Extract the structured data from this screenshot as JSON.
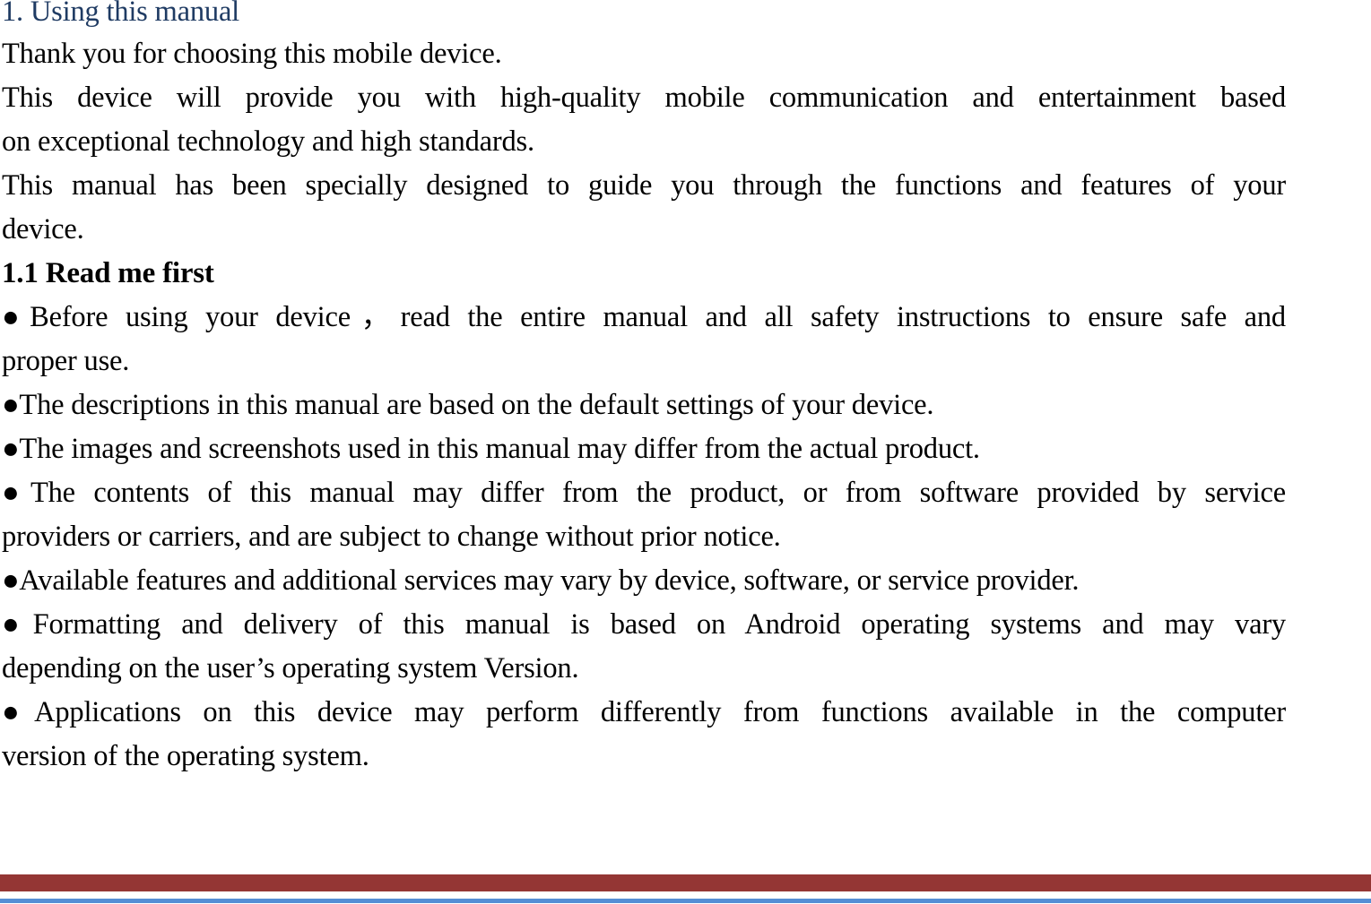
{
  "document": {
    "section_title": "1. Using this manual",
    "intro": {
      "line1": "Thank you for choosing this mobile device.",
      "para2_line1": "This device will provide you with high-quality mobile communication and entertainment based",
      "para2_line2": "on exceptional technology and high standards.",
      "para3_line1": "This manual has been specially designed to guide you through the functions and features of your",
      "para3_line2": "device."
    },
    "subsection_title": "1.1 Read me first",
    "bullets": [
      {
        "line1": "●Before using your device，read the entire manual and all safety instructions to ensure safe and",
        "line2": "proper use."
      },
      {
        "line1": "●The descriptions in this manual are based on the default settings of your device."
      },
      {
        "line1": "●The images and screenshots used in this manual may differ from the actual product."
      },
      {
        "line1": "●The contents of this manual may differ from the product, or from software provided by service",
        "line2": "providers or carriers, and are subject to change without prior notice."
      },
      {
        "line1": "●Available features and additional services may vary by device, software, or service provider."
      },
      {
        "line1": "●Formatting and delivery of this manual is based on Android operating systems and may vary",
        "line2": "depending on the user’s operating system Version."
      },
      {
        "line1": "●Applications on this device may perform differently from functions available in the computer",
        "line2": "version of the operating system."
      }
    ]
  },
  "footer": {
    "primary_color": "#943634",
    "secondary_color": "#558ed5"
  }
}
